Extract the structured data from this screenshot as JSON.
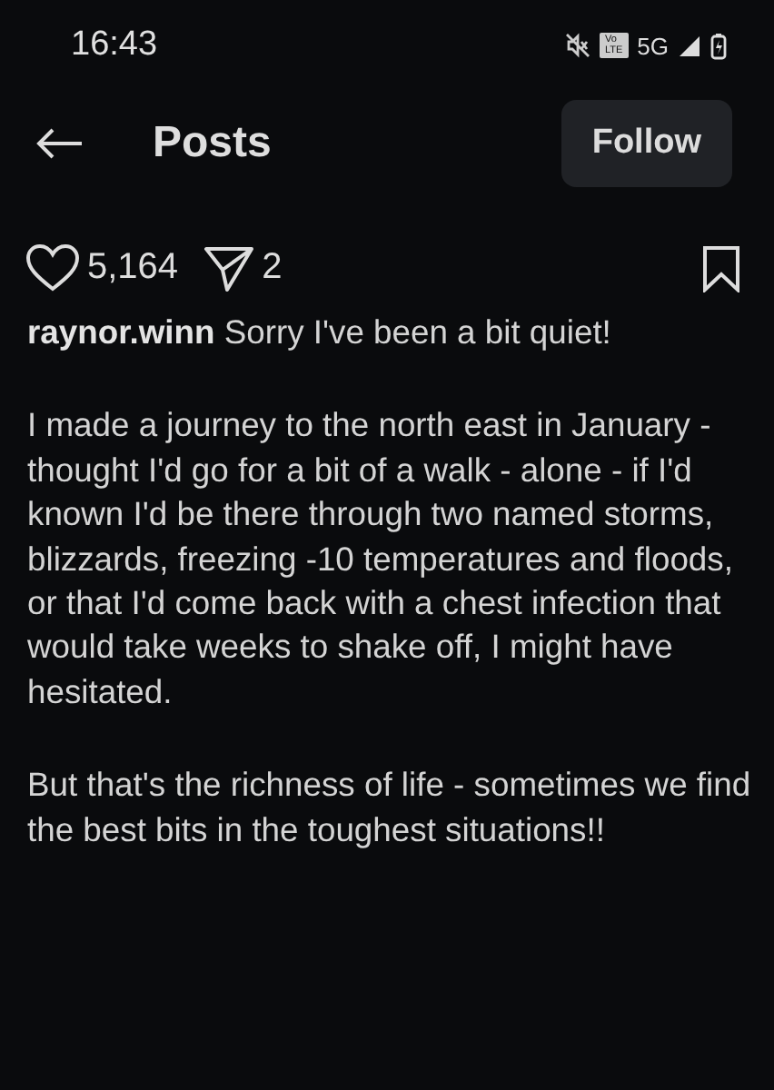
{
  "status_bar": {
    "time": "16:43",
    "volte": [
      "Vo",
      "LTE"
    ],
    "network": "5G",
    "muted": true
  },
  "header": {
    "title": "Posts",
    "follow_button": "Follow"
  },
  "actions": {
    "likes": "5,164",
    "shares": "2",
    "saved": false
  },
  "caption": [
    "**raynor.winn** Sorry I've been a bit quiet!",
    "I made a journey to the north east in January - thought I'd go for a bit of a walk - alone - if I'd known I'd be there through two named storms, blizzards, freezing -10 temperatures and floods, or that I'd come back with a chest infection that would take weeks to shake off, I might have hesitated.",
    "But that's the richness of life - sometimes we find the best bits in the toughest situations!!"
  ]
}
